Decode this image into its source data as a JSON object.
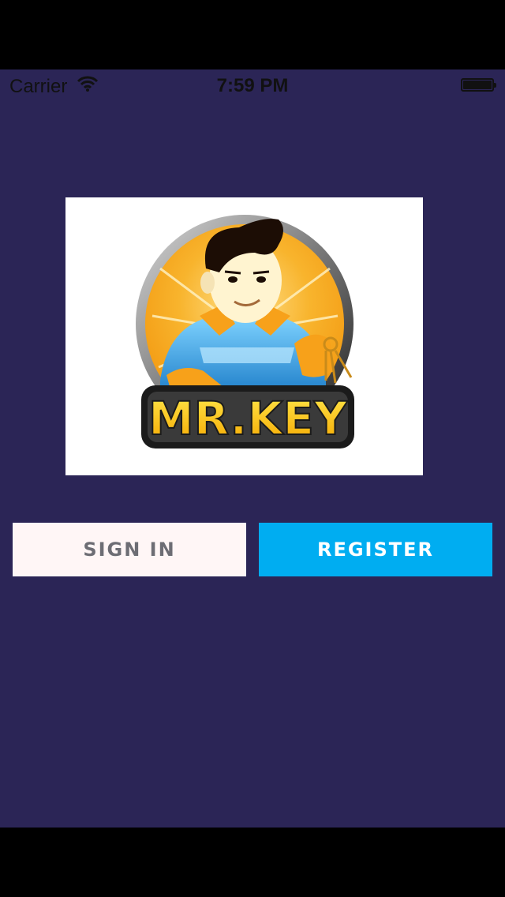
{
  "status_bar": {
    "carrier": "Carrier",
    "time": "7:59 PM",
    "wifi_icon": "wifi-icon",
    "battery_icon": "battery-icon"
  },
  "logo": {
    "text": "MR.KEY",
    "colors": {
      "sun": "#f8b42d",
      "shirt": "#2aa6e4",
      "hair": "#1c0d05",
      "text_fill": "#ffd21a",
      "text_outline": "#1b1b1b"
    }
  },
  "buttons": {
    "sign_in": "SIGN IN",
    "register": "REGISTER"
  },
  "colors": {
    "background": "#2b2556",
    "sign_in_bg": "#fff6f6",
    "register_bg": "#00adf1"
  }
}
